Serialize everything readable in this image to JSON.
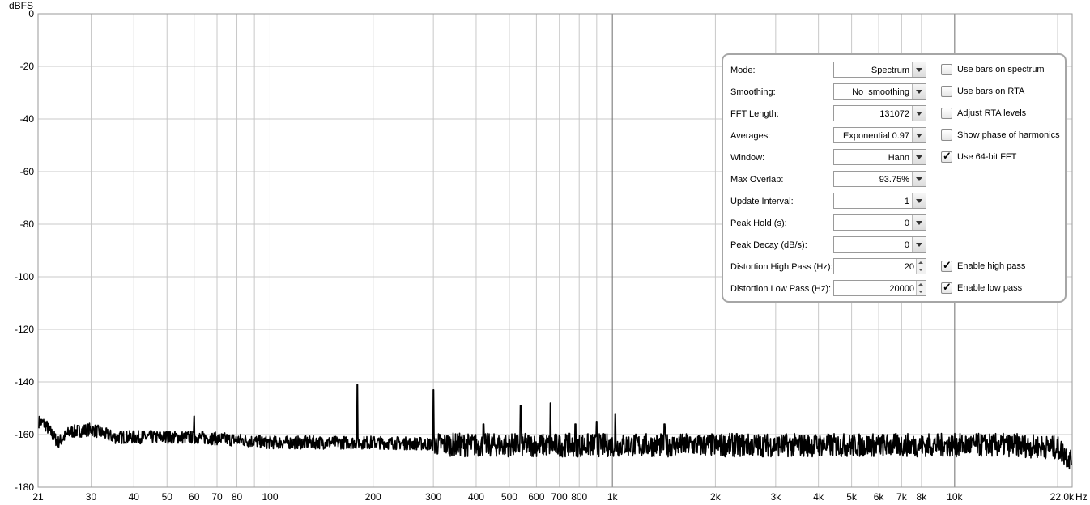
{
  "chart_data": {
    "type": "line",
    "xscale": "log",
    "ylabel": "dBFS",
    "xunit": "Hz",
    "xlim": [
      21,
      22050
    ],
    "ylim": [
      -180,
      0
    ],
    "grid": true,
    "y_ticks": [
      0,
      -20,
      -40,
      -60,
      -80,
      -100,
      -120,
      -140,
      -160,
      -180
    ],
    "y_tick_labels": [
      "0",
      "-20",
      "-40",
      "-60",
      "-80",
      "-100",
      "-120",
      "-140",
      "-160",
      "-180"
    ],
    "x_ticks": [
      21,
      30,
      40,
      50,
      60,
      70,
      80,
      100,
      200,
      300,
      400,
      500,
      600,
      700,
      800,
      1000,
      2000,
      3000,
      4000,
      5000,
      6000,
      7000,
      8000,
      10000,
      22050
    ],
    "x_tick_labels": [
      "21",
      "30",
      "40",
      "50",
      "60",
      "70",
      "80",
      "100",
      "200",
      "300",
      "400",
      "500",
      "600",
      "700",
      "800",
      "1k",
      "2k",
      "3k",
      "4k",
      "5k",
      "6k",
      "7k",
      "8k",
      "10k",
      "22.0k"
    ],
    "series": [
      {
        "noise_floor": [
          [
            21,
            -155
          ],
          [
            22,
            -156
          ],
          [
            24,
            -163
          ],
          [
            26,
            -159
          ],
          [
            30,
            -158
          ],
          [
            35,
            -161
          ],
          [
            40,
            -161
          ],
          [
            50,
            -161
          ],
          [
            60,
            -161
          ],
          [
            80,
            -162
          ],
          [
            100,
            -163
          ],
          [
            200,
            -163
          ],
          [
            400,
            -164
          ],
          [
            1000,
            -164
          ],
          [
            2000,
            -164
          ],
          [
            5000,
            -164
          ],
          [
            10000,
            -164
          ],
          [
            15000,
            -164
          ],
          [
            20000,
            -165
          ],
          [
            22050,
            -170
          ]
        ],
        "peaks": [
          [
            50,
            -159
          ],
          [
            60,
            -153
          ],
          [
            180,
            -141
          ],
          [
            300,
            -143
          ],
          [
            420,
            -156
          ],
          [
            540,
            -149
          ],
          [
            660,
            -148
          ],
          [
            780,
            -156
          ],
          [
            900,
            -155
          ],
          [
            1020,
            -152
          ],
          [
            1420,
            -156
          ]
        ]
      }
    ]
  },
  "settings": {
    "mode": {
      "label": "Mode:",
      "value": "Spectrum"
    },
    "smoothing": {
      "label": "Smoothing:",
      "value": "No  smoothing"
    },
    "fft_length": {
      "label": "FFT Length:",
      "value": "131072"
    },
    "averages": {
      "label": "Averages:",
      "value": "Exponential 0.97"
    },
    "window": {
      "label": "Window:",
      "value": "Hann"
    },
    "max_overlap": {
      "label": "Max Overlap:",
      "value": "93.75%"
    },
    "update_interval": {
      "label": "Update Interval:",
      "value": "1"
    },
    "peak_hold": {
      "label": "Peak Hold (s):",
      "value": "0"
    },
    "peak_decay": {
      "label": "Peak Decay (dB/s):",
      "value": "0"
    },
    "dist_high_pass": {
      "label": "Distortion High Pass (Hz):",
      "value": "20"
    },
    "dist_low_pass": {
      "label": "Distortion Low Pass (Hz):",
      "value": "20000"
    }
  },
  "options": {
    "bars_spectrum": {
      "label": "Use bars on spectrum",
      "checked": false
    },
    "bars_rta": {
      "label": "Use bars on RTA",
      "checked": false
    },
    "adjust_rta": {
      "label": "Adjust RTA levels",
      "checked": false
    },
    "phase_harmonics": {
      "label": "Show phase of harmonics",
      "checked": false
    },
    "fft64": {
      "label": "Use 64-bit FFT",
      "checked": true
    },
    "enable_high_pass": {
      "label": "Enable high pass",
      "checked": true
    },
    "enable_low_pass": {
      "label": "Enable low pass",
      "checked": true
    }
  },
  "check_glyph": "✓"
}
